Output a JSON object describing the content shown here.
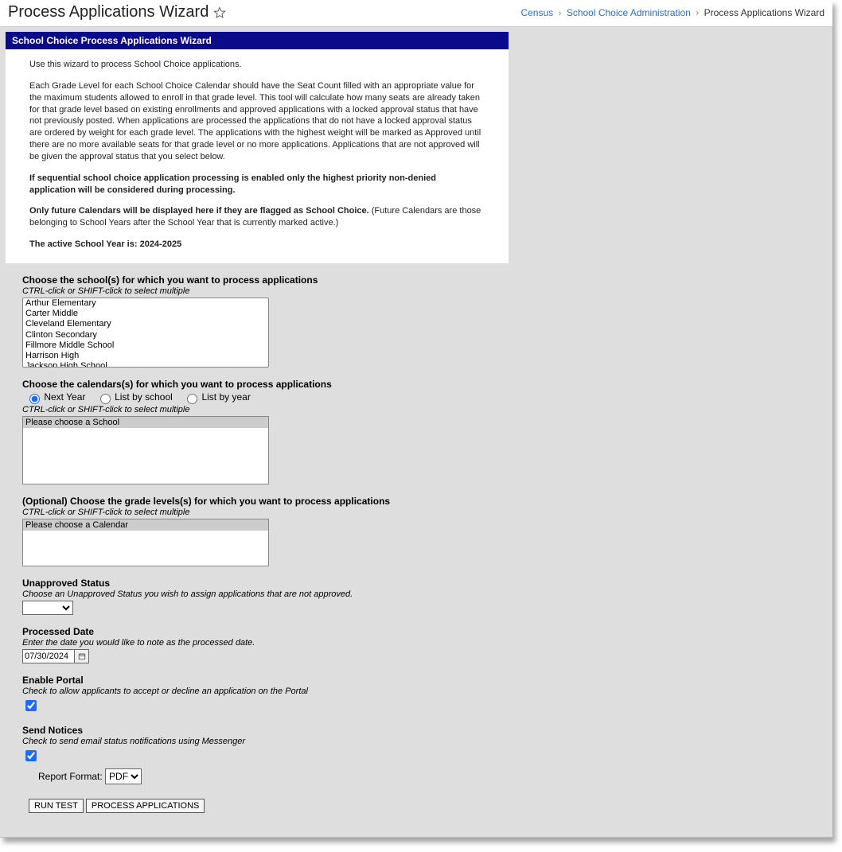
{
  "header": {
    "title": "Process Applications Wizard",
    "breadcrumb": [
      {
        "label": "Census",
        "link": true
      },
      {
        "label": "School Choice Administration",
        "link": true
      },
      {
        "label": "Process Applications Wizard",
        "link": false
      }
    ]
  },
  "panel": {
    "title": "School Choice Process Applications Wizard",
    "intro_p1": "Use this wizard to process School Choice applications.",
    "intro_p2": "Each Grade Level for each School Choice Calendar should have the Seat Count filled with an appropriate value for the maximum students allowed to enroll in that grade level. This tool will calculate how many seats are already taken for that grade level based on existing enrollments and approved applications with a locked approval status that have not previously posted. When applications are processed the applications that do not have a locked approval status are ordered by weight for each grade level. The applications with the highest weight will be marked as Approved until there are no more available seats for that grade level or no more applications. Applications that are not approved will be given the approval status that you select below.",
    "intro_seq": "If sequential school choice application processing is enabled only the highest priority non-denied application will be considered during processing.",
    "intro_future_b": "Only future Calendars will be displayed here if they are flagged as School Choice.",
    "intro_future_r": " (Future Calendars are those belonging to School Years after the School Year that is currently marked active.)",
    "intro_active": "The active School Year is: 2024-2025"
  },
  "schools": {
    "label": "Choose the school(s) for which you want to process applications",
    "hint": "CTRL-click or SHIFT-click to select multiple",
    "options": [
      "Arthur Elementary",
      "Carter Middle",
      "Cleveland Elementary",
      "Clinton Secondary",
      "Fillmore Middle School",
      "Harrison High",
      "Jackson High School"
    ]
  },
  "calendars": {
    "label": "Choose the calendars(s) for which you want to process applications",
    "hint": "CTRL-click or SHIFT-click to select multiple",
    "radios": {
      "next_year": "Next Year",
      "list_by_school": "List by school",
      "list_by_year": "List by year"
    },
    "placeholder": "Please choose a School"
  },
  "grades": {
    "label": "(Optional) Choose the grade levels(s) for which you want to process applications",
    "hint": "CTRL-click or SHIFT-click to select multiple",
    "placeholder": "Please choose a Calendar"
  },
  "unapproved": {
    "label": "Unapproved Status",
    "hint": "Choose an Unapproved Status you wish to assign applications that are not approved."
  },
  "processed_date": {
    "label": "Processed Date",
    "hint": "Enter the date you would like to note as the processed date.",
    "value": "07/30/2024"
  },
  "enable_portal": {
    "label": "Enable Portal",
    "hint": "Check to allow applicants to accept or decline an application on the Portal",
    "checked": true
  },
  "send_notices": {
    "label": "Send Notices",
    "hint": "Check to send email status notifications using Messenger",
    "checked": true
  },
  "report_format": {
    "label": "Report Format:",
    "value": "PDF"
  },
  "buttons": {
    "run_test": "RUN TEST",
    "process": "PROCESS APPLICATIONS"
  }
}
